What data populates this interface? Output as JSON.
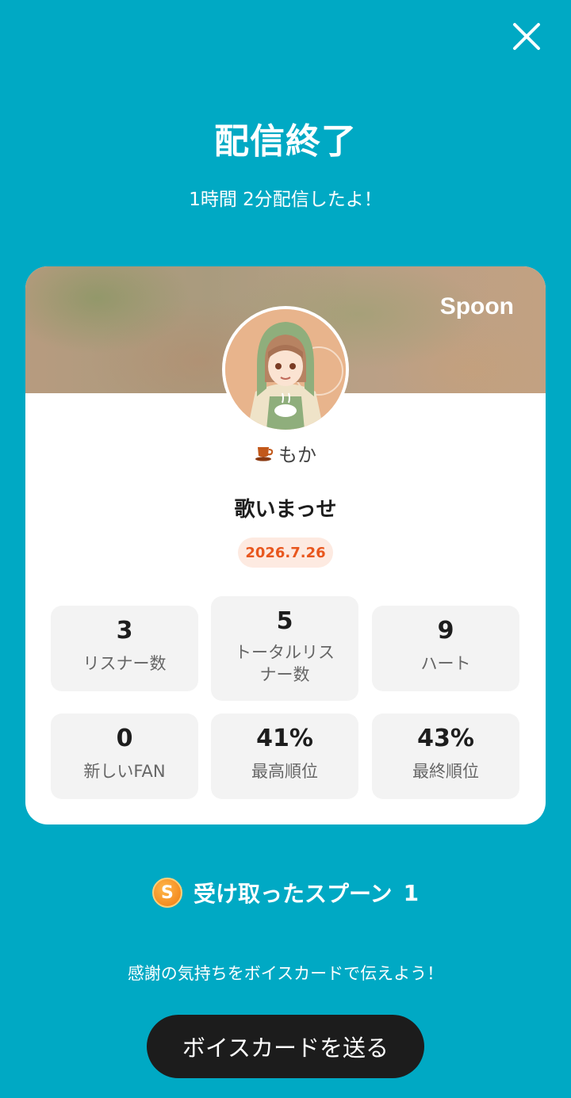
{
  "header": {
    "close_icon": "close-icon",
    "title": "配信終了",
    "subtitle": "1時間 2分配信したよ！"
  },
  "card": {
    "brand": "Spoon",
    "avatar_icon": "avatar-illustration",
    "nickname_icon": "coffee-cup-icon",
    "nickname": "もか",
    "show_title": "歌いまっせ",
    "date": "2026.7.26",
    "stats": [
      {
        "value": "3",
        "label": "リスナー数"
      },
      {
        "value": "5",
        "label": "トータルリスナー数"
      },
      {
        "value": "9",
        "label": "ハート"
      },
      {
        "value": "0",
        "label": "新しいFAN"
      },
      {
        "value": "41%",
        "label": "最高順位"
      },
      {
        "value": "43%",
        "label": "最終順位"
      }
    ]
  },
  "spoons": {
    "icon": "spoon-coin-icon",
    "coin_letter": "S",
    "label": "受け取ったスプーン",
    "count": "1"
  },
  "footer": {
    "thanks_text": "感謝の気持ちをボイスカードで伝えよう！",
    "button_label": "ボイスカードを送る"
  },
  "colors": {
    "background": "#00a9c4",
    "card": "#ffffff",
    "button": "#1c1c1c",
    "date_text": "#e8571e",
    "date_bg": "#fdeae1"
  }
}
